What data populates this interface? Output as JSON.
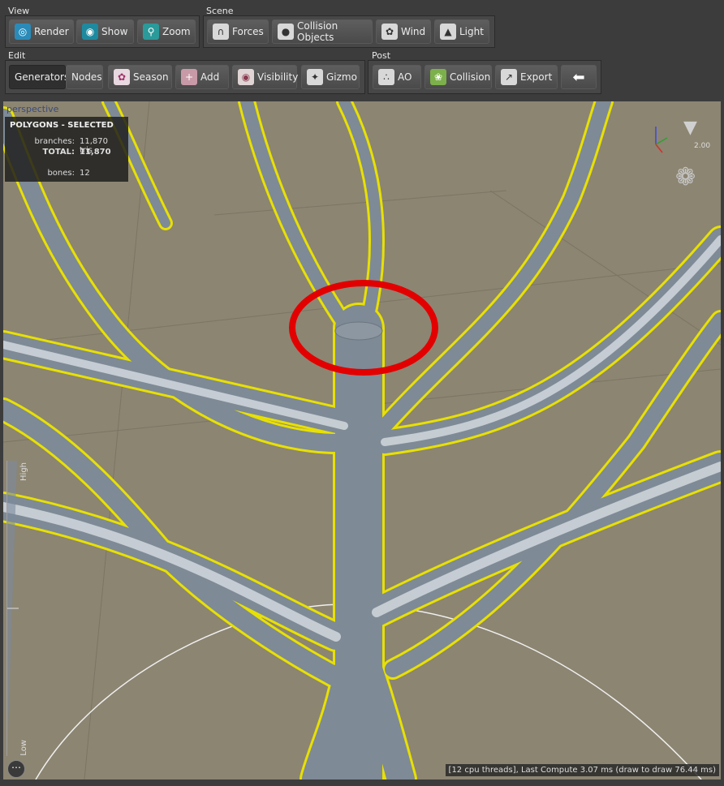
{
  "toolbar": {
    "view": {
      "label": "View",
      "buttons": [
        {
          "label": "Render",
          "icon": "globe-icon"
        },
        {
          "label": "Show",
          "icon": "eye-icon"
        },
        {
          "label": "Zoom",
          "icon": "magnifier-icon"
        }
      ]
    },
    "scene": {
      "label": "Scene",
      "buttons": [
        {
          "label": "Forces",
          "icon": "magnet-icon"
        },
        {
          "label": "Collision Objects",
          "icon": "collision-icon"
        },
        {
          "label": "Wind",
          "icon": "fan-icon"
        },
        {
          "label": "Light",
          "icon": "lamp-icon"
        }
      ]
    },
    "edit": {
      "label": "Edit",
      "buttons": [
        {
          "label": "Generators",
          "active": true
        },
        {
          "label": "Nodes"
        },
        {
          "label": "Season",
          "icon": "season-icon"
        },
        {
          "label": "Add",
          "icon": "add-icon"
        },
        {
          "label": "Visibility",
          "icon": "eyeball-icon"
        },
        {
          "label": "Gizmo",
          "icon": "gizmo-icon"
        }
      ]
    },
    "post": {
      "label": "Post",
      "buttons": [
        {
          "label": "AO",
          "icon": "ao-icon"
        },
        {
          "label": "Collision",
          "icon": "leaf-icon"
        },
        {
          "label": "Export",
          "icon": "export-icon"
        },
        {
          "label": "",
          "icon": "back-arrow-icon"
        }
      ]
    }
  },
  "viewport": {
    "mode": "perspective",
    "stats": {
      "title": "POLYGONS - SELECTED",
      "branches_label": "branches:",
      "branches_value": "11,870 tris",
      "total_label": "TOTAL:",
      "total_value": "11,870",
      "bones_label": "bones:",
      "bones_value": "12"
    },
    "light_intensity": "2.00",
    "lod_high": "High",
    "lod_low": "Low",
    "status": "[12 cpu threads], Last Compute 3.07 ms (draw to draw 76.44 ms)"
  },
  "colors": {
    "ground": "#8c8572",
    "branch": "#7e8a96",
    "selection_outline": "#e8e000",
    "annotation_circle": "#e30000"
  }
}
